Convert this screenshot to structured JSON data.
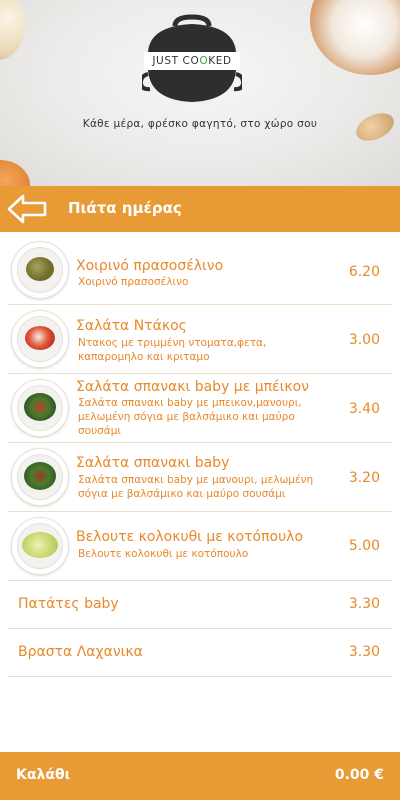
{
  "header": {
    "logo_text_a": "JUST CO",
    "logo_text_b": "O",
    "logo_text_c": "KED",
    "tagline": "Κάθε μέρα, φρέσκο φαγητό, στο χώρο σου"
  },
  "titlebar": {
    "title": "Πιάτα ημέρας",
    "back_icon": "back-arrow-icon"
  },
  "items": [
    {
      "name": "Χοιρινό πρασοσέλινο",
      "desc": "Χοιρινό πρασοσέλινο",
      "price": "6.20"
    },
    {
      "name": "Σαλάτα Ντάκος",
      "desc": "Ντακος με τριμμένη ντοματα,φετα, καπαρομηλο και κριταμο",
      "price": "3.00"
    },
    {
      "name": "Σαλάτα σπανακι baby με μπέικον",
      "desc": "Σαλάτα σπανακι baby με μπεικον,μανουρι, μελωμένη σόγια με βαλσάμικο και μαύρο σουσάμι",
      "price": "3.40"
    },
    {
      "name": "Σαλάτα σπανακι baby",
      "desc": "Σαλάτα σπανακι baby με μανουρι, μελωμένη σόγια με βαλσάμικο και μαύρο σουσάμι",
      "price": "3.20"
    },
    {
      "name": "Βελουτε κολοκυθι με κοτόπουλο",
      "desc": "Βελουτε κολοκυθι με κοτόπουλο",
      "price": "5.00"
    }
  ],
  "plain_items": [
    {
      "name": "Πατάτες baby",
      "price": "3.30"
    },
    {
      "name": "Βραστα Λαχανικα",
      "price": "3.30"
    }
  ],
  "cart": {
    "label": "Καλάθι",
    "total": "0.00 €"
  },
  "colors": {
    "accent": "#e89a34",
    "text_accent": "#e8892a",
    "logo_green": "#3aa24b"
  }
}
